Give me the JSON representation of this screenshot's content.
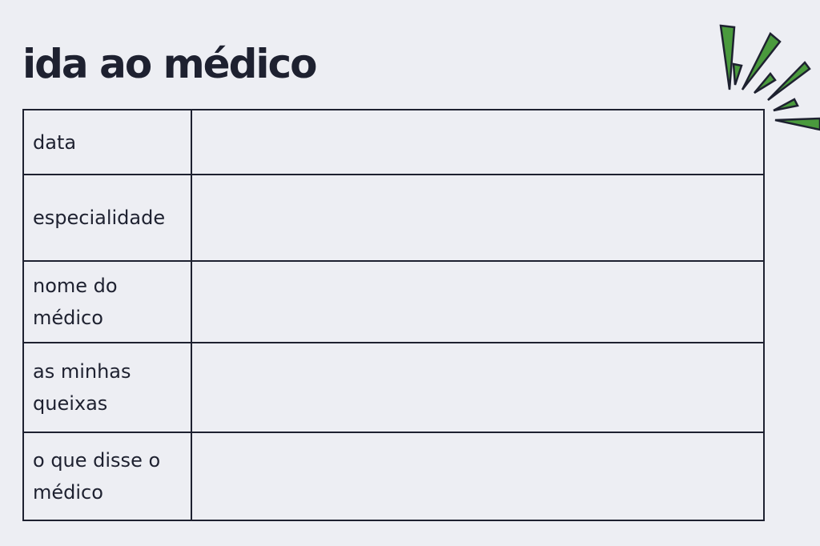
{
  "title": "ida ao médico",
  "colors": {
    "background": "#edeef3",
    "ink": "#1e2130",
    "accent": "#4a9a3d"
  },
  "decoration": {
    "icon": "burst-lines-icon"
  },
  "rows": [
    {
      "label": "data"
    },
    {
      "label": "especialidade"
    },
    {
      "label": "nome do\nmédico"
    },
    {
      "label": "as minhas\nqueixas"
    },
    {
      "label": "o que disse o\nmédico"
    }
  ]
}
